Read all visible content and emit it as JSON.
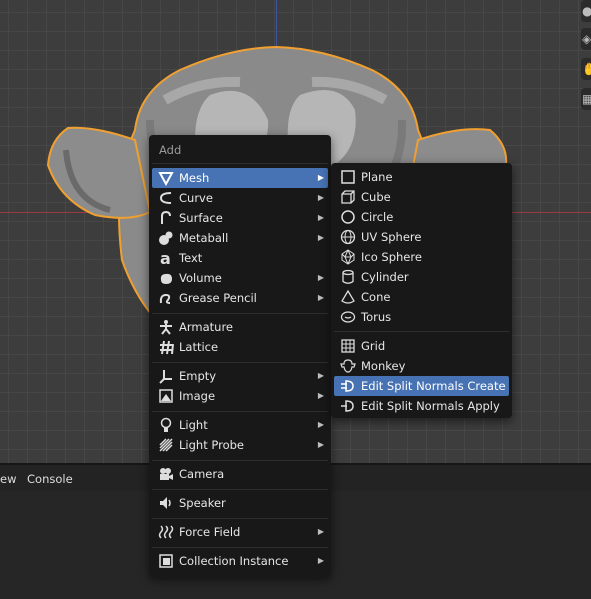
{
  "editor_header": {
    "tab_view_partial": "ew",
    "tab_console": "Console"
  },
  "add_menu": {
    "title": "Add",
    "items": [
      {
        "label": "Mesh",
        "icon": "mesh-icon",
        "submenu": true,
        "active": true
      },
      {
        "label": "Curve",
        "icon": "curve-icon",
        "submenu": true
      },
      {
        "label": "Surface",
        "icon": "surface-icon",
        "submenu": true
      },
      {
        "label": "Metaball",
        "icon": "metaball-icon",
        "submenu": true
      },
      {
        "label": "Text",
        "icon": "text-icon",
        "submenu": false
      },
      {
        "label": "Volume",
        "icon": "volume-icon",
        "submenu": true
      },
      {
        "label": "Grease Pencil",
        "icon": "grease-pencil-icon",
        "submenu": true
      },
      {
        "label": "Armature",
        "icon": "armature-icon",
        "submenu": false
      },
      {
        "label": "Lattice",
        "icon": "lattice-icon",
        "submenu": false
      },
      {
        "label": "Empty",
        "icon": "empty-icon",
        "submenu": true
      },
      {
        "label": "Image",
        "icon": "image-icon",
        "submenu": true
      },
      {
        "label": "Light",
        "icon": "light-icon",
        "submenu": true
      },
      {
        "label": "Light Probe",
        "icon": "light-probe-icon",
        "submenu": true
      },
      {
        "label": "Camera",
        "icon": "camera-icon",
        "submenu": false
      },
      {
        "label": "Speaker",
        "icon": "speaker-icon",
        "submenu": false
      },
      {
        "label": "Force Field",
        "icon": "force-field-icon",
        "submenu": true
      },
      {
        "label": "Collection Instance",
        "icon": "collection-instance-icon",
        "submenu": true
      }
    ]
  },
  "mesh_submenu": {
    "items": [
      {
        "label": "Plane",
        "icon": "plane-icon"
      },
      {
        "label": "Cube",
        "icon": "cube-icon"
      },
      {
        "label": "Circle",
        "icon": "circle-icon"
      },
      {
        "label": "UV Sphere",
        "icon": "uv-sphere-icon"
      },
      {
        "label": "Ico Sphere",
        "icon": "ico-sphere-icon"
      },
      {
        "label": "Cylinder",
        "icon": "cylinder-icon"
      },
      {
        "label": "Cone",
        "icon": "cone-icon"
      },
      {
        "label": "Torus",
        "icon": "torus-icon"
      },
      {
        "label": "Grid",
        "icon": "grid-icon"
      },
      {
        "label": "Monkey",
        "icon": "monkey-icon"
      },
      {
        "label": "Edit Split Normals Create",
        "icon": "split-normals-create-icon",
        "active": true
      },
      {
        "label": "Edit Split Normals Apply",
        "icon": "split-normals-apply-icon"
      }
    ]
  },
  "colors": {
    "highlight": "#4772b3",
    "selection_outline": "#f0a030",
    "menu_bg": "#181818"
  }
}
